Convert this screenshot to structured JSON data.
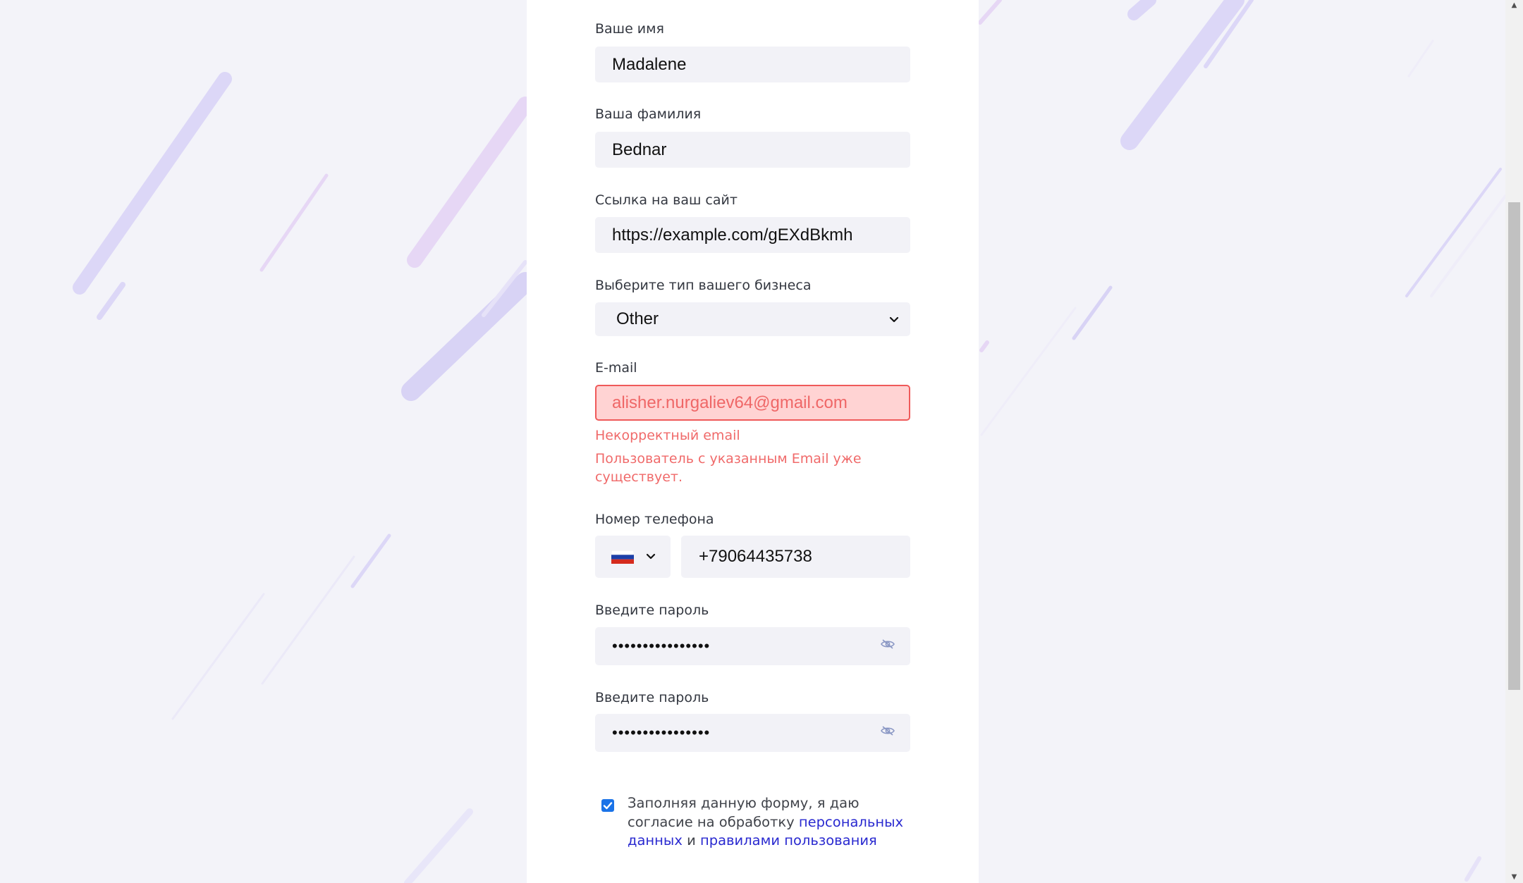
{
  "form": {
    "first_name": {
      "label": "Ваше имя",
      "value": "Madalene"
    },
    "last_name": {
      "label": "Ваша фамилия",
      "value": "Bednar"
    },
    "website": {
      "label": "Ссылка на ваш сайт",
      "value": "https://example.com/gEXdBkmh"
    },
    "business_type": {
      "label": "Выберите тип вашего бизнеса",
      "value": "Other"
    },
    "email": {
      "label": "E-mail",
      "value": "alisher.nurgaliev64@gmail.com",
      "error_invalid": "Некорректный email",
      "error_exists": "Пользователь с указанным Email уже существует."
    },
    "phone": {
      "label": "Номер телефона",
      "country": "RU",
      "value": "+79064435738"
    },
    "password": {
      "label": "Введите пароль",
      "value": "••••••••••••••••"
    },
    "password_confirm": {
      "label": "Введите пароль",
      "value": "••••••••••••••••"
    },
    "consent": {
      "checked": true,
      "text_before": "Заполняя данную форму, я даю согласие на обработку ",
      "link_personal": "персональных данных",
      "text_middle": " и ",
      "link_rules": "правилами пользования"
    }
  },
  "colors": {
    "accent_link": "#2a2ad0",
    "error": "#f06a6a",
    "input_bg": "#f2f2f7",
    "decor_lines": "#d8d3f5"
  },
  "icons": {
    "select_chevron": "chevron-down-icon",
    "phone_chevron": "chevron-down-icon",
    "password_eye": "eye-off-icon",
    "flag": "russia-flag-icon"
  }
}
